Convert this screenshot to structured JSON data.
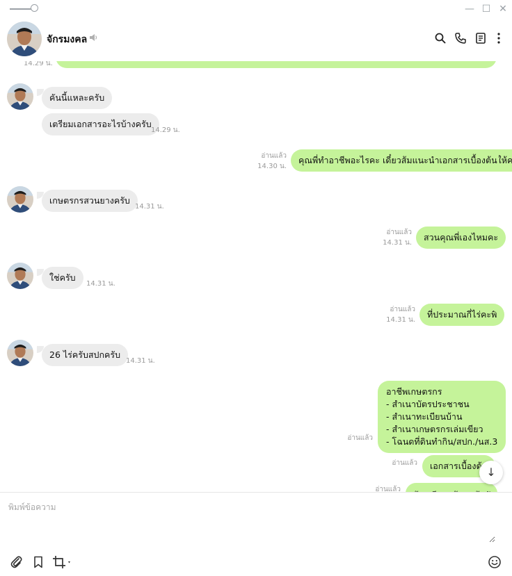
{
  "window": {
    "minimize_glyph": "—",
    "maximize_glyph": "☐",
    "close_glyph": "✕"
  },
  "header": {
    "contact_name": "จักรมงคล",
    "icons": [
      "speaker-icon",
      "search-icon",
      "phone-icon",
      "notes-icon",
      "more-icon"
    ]
  },
  "messages": {
    "top_partial_time": "14.29 น.",
    "m1": {
      "text": "คันนี้แหละครับ"
    },
    "m2": {
      "text": "เตรียมเอกสารอะไรบ้างครับ",
      "time": "14.29 น."
    },
    "m3": {
      "text": "คุณพี่ทำอาชีพอะไรคะ เดี๋ยวส้มแนะนำเอกสารเบื้องต้นให้คะ",
      "read": "อ่านแล้ว",
      "time": "14.30 น."
    },
    "m4": {
      "text": "เกษตรกรสวนยางครับ",
      "time": "14.31 น."
    },
    "m5": {
      "text": "สวนคุณพี่เองไหมคะ",
      "read": "อ่านแล้ว",
      "time": "14.31 น."
    },
    "m6": {
      "text": "ใช่ครับ",
      "time": "14.31 น."
    },
    "m7": {
      "text": "ที่ประมาณกี่ไร่คะพี่",
      "read": "อ่านแล้ว",
      "time": "14.31 น."
    },
    "m8": {
      "text": "26 ไร่ครับสปกครับ",
      "time": "14.31 น."
    },
    "m9": {
      "lines": [
        "อาชีพเกษตรกร",
        "- สำเนาบัตรประชาชน",
        "- สำเนาทะเบียนบ้าน",
        "- สำเนาเกษตรกรเล่มเขียว",
        "- โฉนดที่ดินทำกิน/สปก./นส.3"
      ],
      "read": "อ่านแล้ว"
    },
    "m10": {
      "text": "เอกสารเบื้องต้น",
      "read": "อ่านแล้ว"
    },
    "m11": {
      "text": "ถ้าเตรียมพร้อมแล้วนัดหมายได้",
      "read": "อ่านแล้ว"
    }
  },
  "scroll_button": {
    "glyph": "↓"
  },
  "composer": {
    "placeholder": "พิมพ์ข้อความ",
    "value": "",
    "tools": [
      "attachment-icon",
      "bookmark-icon",
      "crop-icon",
      "emoji-icon"
    ]
  },
  "colors": {
    "incoming_bubble": "#ececec",
    "outgoing_bubble": "#c5f39a",
    "meta_text": "#9a9a9a"
  }
}
